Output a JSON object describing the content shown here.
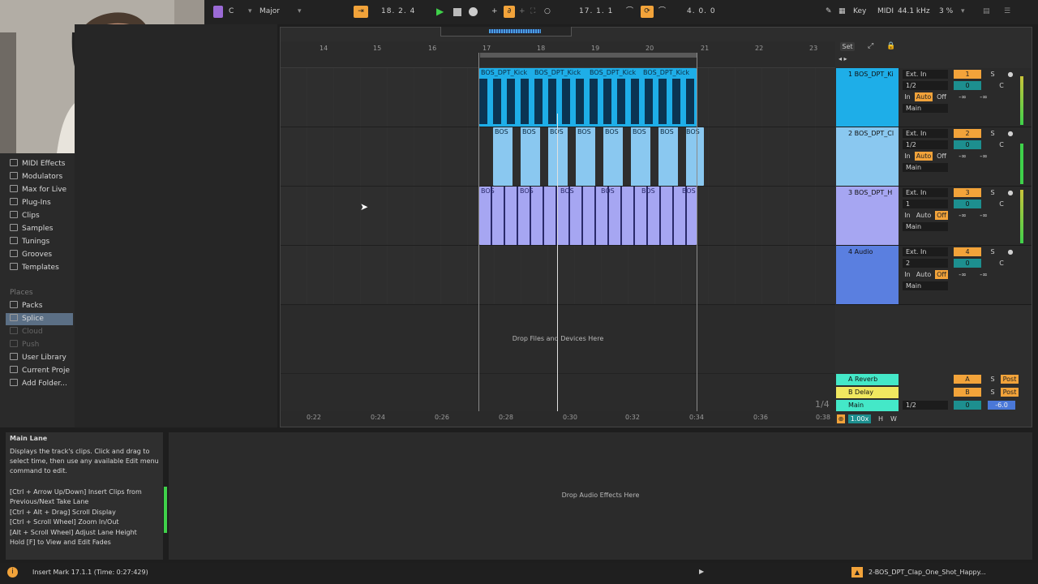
{
  "topbar": {
    "key": "C",
    "scale": "Major",
    "position": "18.  2.  4",
    "loop_start": "17.  1.  1",
    "loop_length": "4.  0.  0",
    "key_label": "Key",
    "midi_label": "MIDI",
    "sample_rate": "44.1 kHz",
    "cpu": "3 %"
  },
  "browser": {
    "items": [
      "MIDI Effects",
      "Modulators",
      "Max for Live",
      "Plug-Ins",
      "Clips",
      "Samples",
      "Tunings",
      "Grooves",
      "Templates"
    ],
    "places_label": "Places",
    "places": [
      "Packs",
      "Splice",
      "Cloud",
      "Push",
      "User Library",
      "Current Proje",
      "Add Folder..."
    ]
  },
  "ruler": {
    "bars": [
      "14",
      "15",
      "16",
      "17",
      "18",
      "19",
      "20",
      "21",
      "22",
      "23"
    ]
  },
  "tracks": [
    {
      "name": "1 BOS_DPT_Ki",
      "input": "Ext. In",
      "channel": "1/2",
      "monitor": [
        "In",
        "Auto",
        "Off"
      ],
      "output": "Main",
      "number": "1",
      "solo": "S",
      "volume": "0",
      "pan": "C",
      "send_a": "-∞",
      "send_b": "-∞",
      "color": "#1eaee8"
    },
    {
      "name": "2 BOS_DPT_Cl",
      "input": "Ext. In",
      "channel": "1/2",
      "monitor": [
        "In",
        "Auto",
        "Off"
      ],
      "output": "Main",
      "number": "2",
      "solo": "S",
      "volume": "0",
      "pan": "C",
      "send_a": "-∞",
      "send_b": "-∞",
      "color": "#8ac8f0"
    },
    {
      "name": "3 BOS_DPT_H",
      "input": "Ext. In",
      "channel": "1",
      "monitor": [
        "In",
        "Auto",
        "Off"
      ],
      "output": "Main",
      "number": "3",
      "solo": "S",
      "volume": "0",
      "pan": "C",
      "send_a": "-∞",
      "send_b": "-∞",
      "color": "#a6a6f2"
    },
    {
      "name": "4 Audio",
      "input": "Ext. In",
      "channel": "2",
      "monitor": [
        "In",
        "Auto",
        "Off"
      ],
      "output": "Main",
      "number": "4",
      "solo": "S",
      "volume": "0",
      "pan": "C",
      "send_a": "-∞",
      "send_b": "-∞",
      "color": "#5a7fe0"
    }
  ],
  "clips": {
    "kick": "BOS_DPT_Kick",
    "clap": "BOS",
    "hat": "BOS"
  },
  "drop_files": "Drop Files and Devices Here",
  "returns": [
    {
      "name": "A Reverb",
      "letter": "A",
      "solo": "S",
      "post": "Post"
    },
    {
      "name": "B Delay",
      "letter": "B",
      "solo": "S",
      "post": "Post"
    }
  ],
  "main": {
    "name": "Main",
    "channel": "1/2",
    "volume": "0",
    "db": "-6.0"
  },
  "set_label": "Set",
  "fraction": "1/4",
  "time_ruler": [
    "0:22",
    "0:24",
    "0:26",
    "0:28",
    "0:30",
    "0:32",
    "0:34",
    "0:36",
    "0:38"
  ],
  "zoom": "1.00x",
  "h_label": "H",
  "w_label": "W",
  "info": {
    "title": "Main Lane",
    "body": [
      "Displays the track's clips. Click and drag to",
      "select time, then use any available Edit menu",
      "command to edit.",
      "",
      "[Ctrl + Arrow Up/Down] Insert Clips from",
      "Previous/Next Take Lane",
      "[Ctrl + Alt + Drag] Scroll Display",
      "[Ctrl + Scroll Wheel] Zoom In/Out",
      "[Alt + Scroll Wheel] Adjust Lane Height",
      "Hold [F] to View and Edit Fades"
    ]
  },
  "drop_effects": "Drop Audio Effects Here",
  "status": {
    "message": "Insert Mark 17.1.1 (Time: 0:27:429)",
    "file": "2-BOS_DPT_Clap_One_Shot_Happy..."
  }
}
